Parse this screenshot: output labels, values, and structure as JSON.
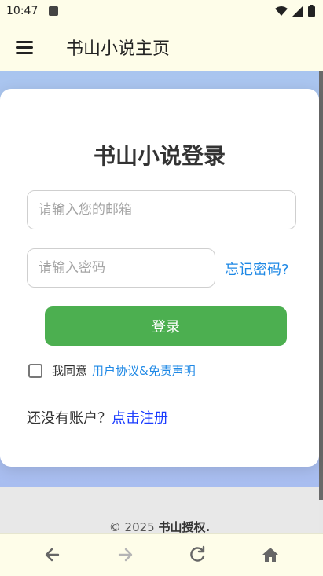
{
  "status_bar": {
    "time": "10:47",
    "icons": [
      "app-badge-icon",
      "wifi-icon",
      "signal-icon",
      "battery-icon"
    ]
  },
  "app_bar": {
    "title": "书山小说主页",
    "menu_icon": "hamburger-menu-icon"
  },
  "login": {
    "heading": "书山小说登录",
    "email_placeholder": "请输入您的邮箱",
    "email_value": "",
    "password_placeholder": "请输入密码",
    "password_value": "",
    "forgot_label": "忘记密码?",
    "submit_label": "登录",
    "agree_prefix": "我同意",
    "agree_link": "用户协议&免责声明",
    "agree_checked": false,
    "signup_prompt": "还没有账户？",
    "signup_link": "点击注册"
  },
  "footer": {
    "copyright_prefix": "© 2025 ",
    "copyright_brand": "书山授权."
  },
  "browser_nav": {
    "icons": [
      "back-arrow-icon",
      "forward-arrow-icon",
      "reload-icon",
      "home-icon"
    ]
  },
  "colors": {
    "primary_button": "#4caf50",
    "link_blue": "#1e88e5",
    "signup_link": "#1a3cff",
    "app_bar_bg": "#fefde9"
  }
}
